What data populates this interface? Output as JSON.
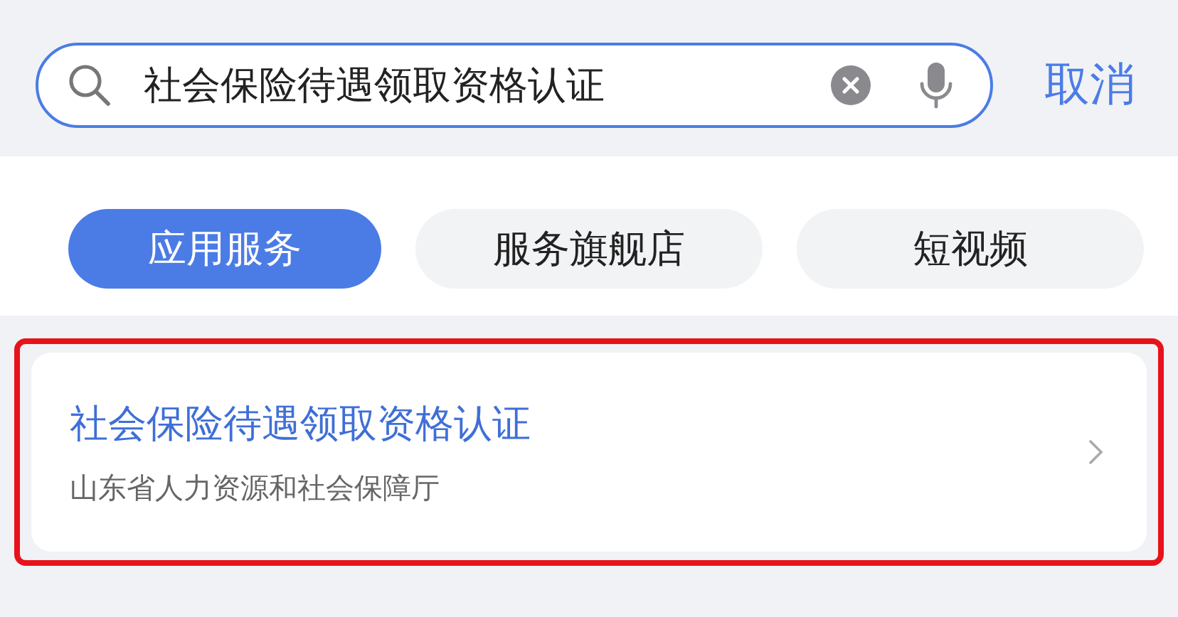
{
  "search": {
    "value": "社会保险待遇领取资格认证",
    "cancel": "取消"
  },
  "tabs": [
    {
      "label": "应用服务",
      "selected": true
    },
    {
      "label": "服务旗舰店",
      "selected": false
    },
    {
      "label": "短视频",
      "selected": false
    }
  ],
  "results": [
    {
      "title": "社会保险待遇领取资格认证",
      "subtitle": "山东省人力资源和社会保障厅",
      "highlighted": true
    }
  ]
}
